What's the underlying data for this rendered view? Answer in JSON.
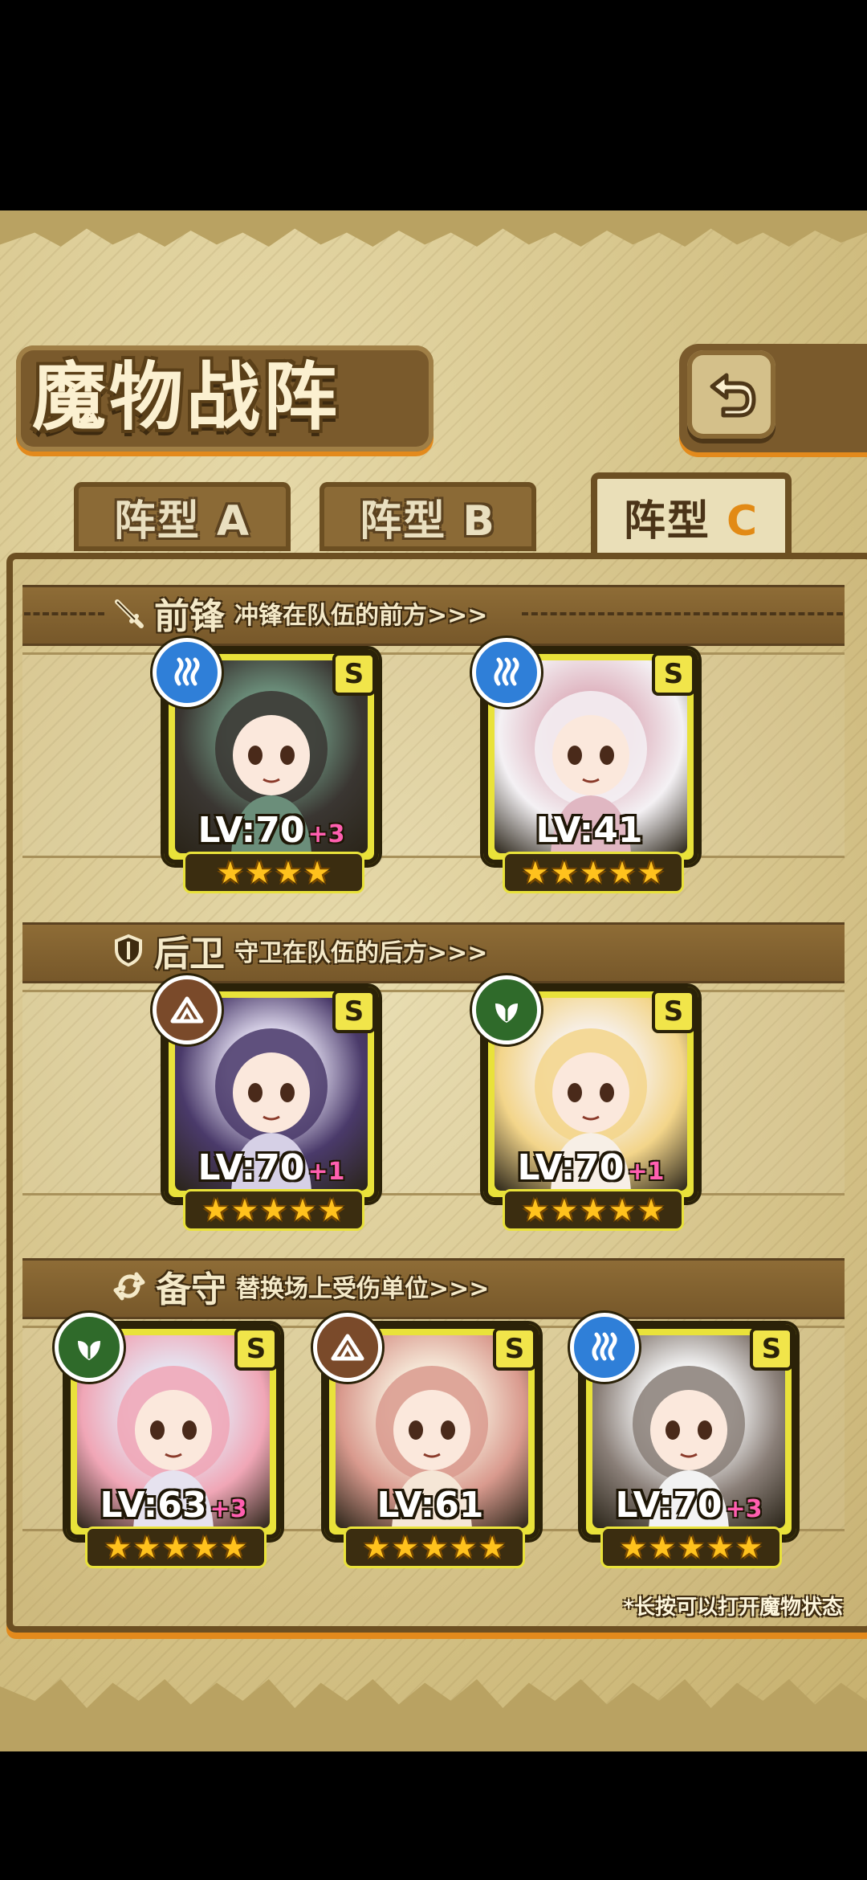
{
  "header": {
    "title": "魔物战阵",
    "back_icon": "back-arrow-icon"
  },
  "tabs": [
    {
      "label": "阵型 A",
      "active": false
    },
    {
      "label": "阵型 B",
      "active": false
    },
    {
      "label_main": "阵型",
      "label_letter": "C",
      "active": true
    }
  ],
  "sections": {
    "front": {
      "name": "前锋",
      "desc": "冲锋在队伍的前方>>>",
      "icon": "sword-icon"
    },
    "back": {
      "name": "后卫",
      "desc": "守卫在队伍的后方>>>",
      "icon": "shield-icon"
    },
    "reserve": {
      "name": "备守",
      "desc": "替换场上受伤单位>>>",
      "icon": "swap-icon"
    }
  },
  "cards": {
    "front1": {
      "rank": "S",
      "element": "water",
      "level": "LV:70",
      "plus": "+3",
      "stars": 4
    },
    "front2": {
      "rank": "S",
      "element": "water",
      "level": "LV:41",
      "plus": "",
      "stars": 5
    },
    "back1": {
      "rank": "S",
      "element": "earth",
      "level": "LV:70",
      "plus": "+1",
      "stars": 5
    },
    "back2": {
      "rank": "S",
      "element": "wood",
      "level": "LV:70",
      "plus": "+1",
      "stars": 5
    },
    "res1": {
      "rank": "S",
      "element": "wood",
      "level": "LV:63",
      "plus": "+3",
      "stars": 5
    },
    "res2": {
      "rank": "S",
      "element": "earth",
      "level": "LV:61",
      "plus": "",
      "stars": 5
    },
    "res3": {
      "rank": "S",
      "element": "water",
      "level": "LV:70",
      "plus": "+3",
      "stars": 5
    }
  },
  "colors": {
    "water": "#2f7fd8",
    "earth": "#7a4a2a",
    "wood": "#2f6a2a",
    "accent": "#e38a1c"
  },
  "footer": {
    "hint": "*长按可以打开魔物状态"
  }
}
